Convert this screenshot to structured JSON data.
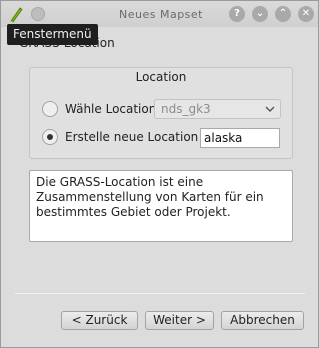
{
  "window": {
    "title": "Neues Mapset",
    "tooltip": "Fenstermenü",
    "controls": [
      {
        "symbol": "?"
      },
      {
        "symbol": "⌄"
      },
      {
        "symbol": "⌃"
      },
      {
        "symbol": "✕"
      }
    ]
  },
  "page": {
    "heading": "GRASS-Location"
  },
  "location_group": {
    "title": "Location",
    "option_select": {
      "label": "Wähle Location",
      "checked": false
    },
    "option_create": {
      "label": "Erstelle neue Location",
      "checked": true
    },
    "select_value": "nds_gk3",
    "new_location_value": "alaska"
  },
  "description": "Die GRASS-Location ist eine Zusammenstellung von Karten für ein bestimmtes Gebiet oder Projekt.",
  "buttons": {
    "back": "< Zurück",
    "next": "Weiter >",
    "cancel": "Abbrechen"
  }
}
